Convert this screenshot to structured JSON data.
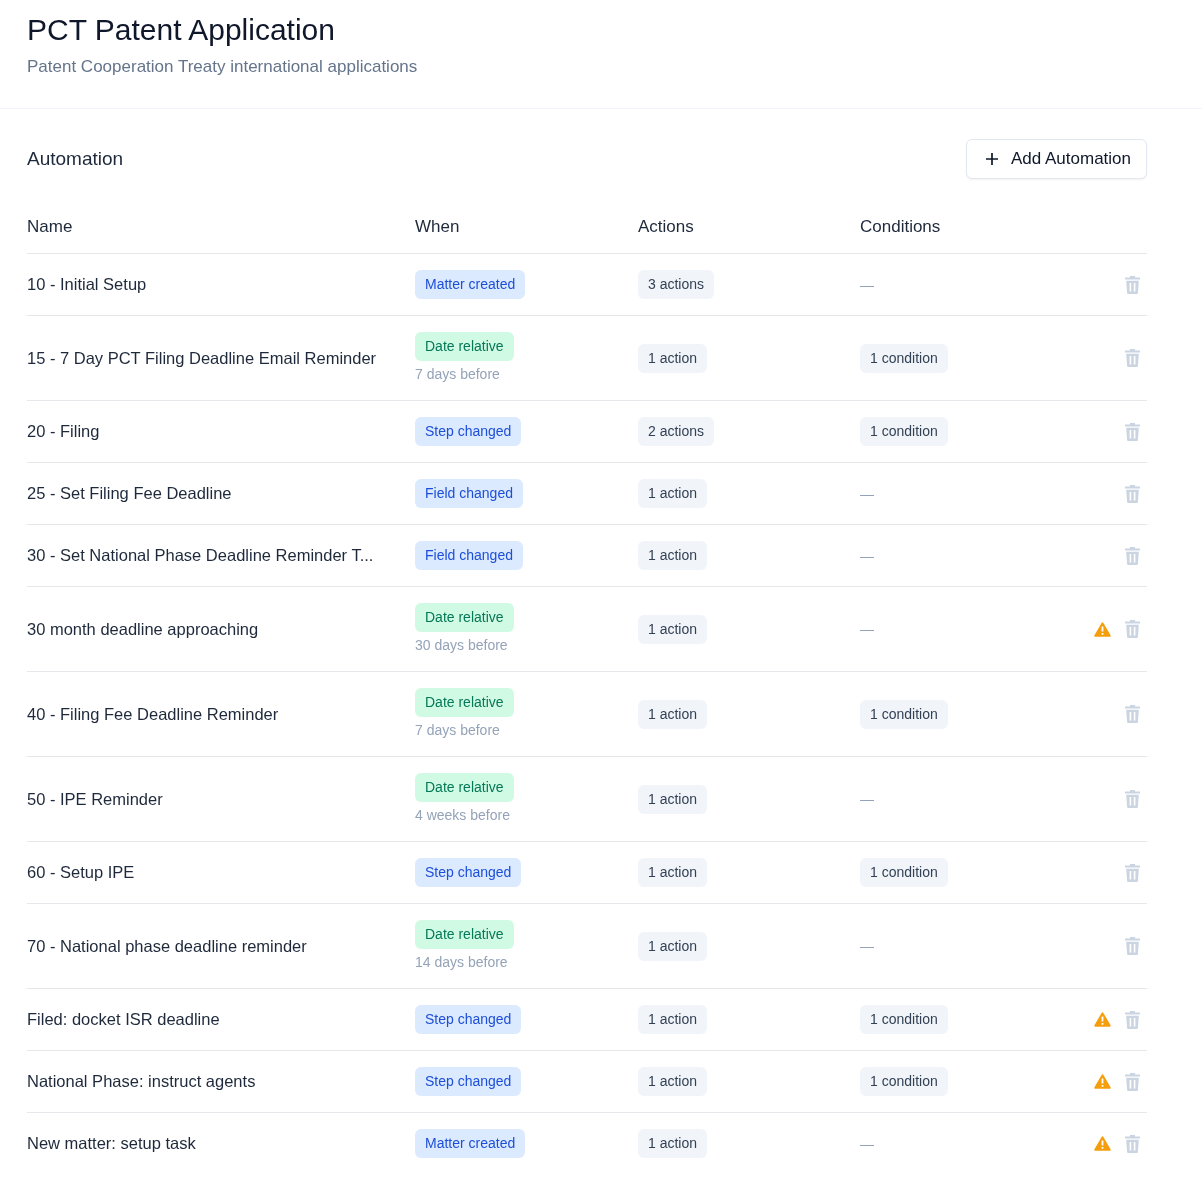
{
  "page": {
    "title": "PCT Patent Application",
    "subtitle": "Patent Cooperation Treaty international applications"
  },
  "automation": {
    "heading": "Automation",
    "add_button": "Add Automation"
  },
  "table": {
    "columns": [
      "Name",
      "When",
      "Actions",
      "Conditions"
    ],
    "rows": [
      {
        "name": "10 - Initial Setup",
        "trigger": {
          "kind": "event",
          "label": "Matter created"
        },
        "actions": "3 actions",
        "conditions": {
          "kind": "empty",
          "label": "—"
        },
        "warning": false
      },
      {
        "name": "15 - 7 Day PCT Filing Deadline Email Reminder",
        "trigger": {
          "kind": "relative",
          "label": "Date relative",
          "offset": "7 days before"
        },
        "actions": "1 action",
        "conditions": {
          "kind": "count",
          "label": "1 condition"
        },
        "warning": false
      },
      {
        "name": "20 - Filing",
        "trigger": {
          "kind": "event",
          "label": "Step changed"
        },
        "actions": "2 actions",
        "conditions": {
          "kind": "count",
          "label": "1 condition"
        },
        "warning": false
      },
      {
        "name": "25 - Set Filing Fee Deadline",
        "trigger": {
          "kind": "event",
          "label": "Field changed"
        },
        "actions": "1 action",
        "conditions": {
          "kind": "empty",
          "label": "—"
        },
        "warning": false
      },
      {
        "name": "30 - Set National Phase Deadline Reminder T...",
        "trigger": {
          "kind": "event",
          "label": "Field changed"
        },
        "actions": "1 action",
        "conditions": {
          "kind": "empty",
          "label": "—"
        },
        "warning": false
      },
      {
        "name": "30 month deadline approaching",
        "trigger": {
          "kind": "relative",
          "label": "Date relative",
          "offset": "30 days before"
        },
        "actions": "1 action",
        "conditions": {
          "kind": "empty",
          "label": "—"
        },
        "warning": true
      },
      {
        "name": "40 - Filing Fee Deadline Reminder",
        "trigger": {
          "kind": "relative",
          "label": "Date relative",
          "offset": "7 days before"
        },
        "actions": "1 action",
        "conditions": {
          "kind": "count",
          "label": "1 condition"
        },
        "warning": false
      },
      {
        "name": "50 - IPE Reminder",
        "trigger": {
          "kind": "relative",
          "label": "Date relative",
          "offset": "4 weeks before"
        },
        "actions": "1 action",
        "conditions": {
          "kind": "empty",
          "label": "—"
        },
        "warning": false
      },
      {
        "name": "60 - Setup IPE",
        "trigger": {
          "kind": "event",
          "label": "Step changed"
        },
        "actions": "1 action",
        "conditions": {
          "kind": "count",
          "label": "1 condition"
        },
        "warning": false
      },
      {
        "name": "70 - National phase deadline reminder",
        "trigger": {
          "kind": "relative",
          "label": "Date relative",
          "offset": "14 days before"
        },
        "actions": "1 action",
        "conditions": {
          "kind": "empty",
          "label": "—"
        },
        "warning": false
      },
      {
        "name": "Filed: docket ISR deadline",
        "trigger": {
          "kind": "event",
          "label": "Step changed"
        },
        "actions": "1 action",
        "conditions": {
          "kind": "count",
          "label": "1 condition"
        },
        "warning": true
      },
      {
        "name": "National Phase: instruct agents",
        "trigger": {
          "kind": "event",
          "label": "Step changed"
        },
        "actions": "1 action",
        "conditions": {
          "kind": "count",
          "label": "1 condition"
        },
        "warning": true
      },
      {
        "name": "New matter: setup task",
        "trigger": {
          "kind": "event",
          "label": "Matter created"
        },
        "actions": "1 action",
        "conditions": {
          "kind": "empty",
          "label": "—"
        },
        "warning": true
      }
    ]
  }
}
